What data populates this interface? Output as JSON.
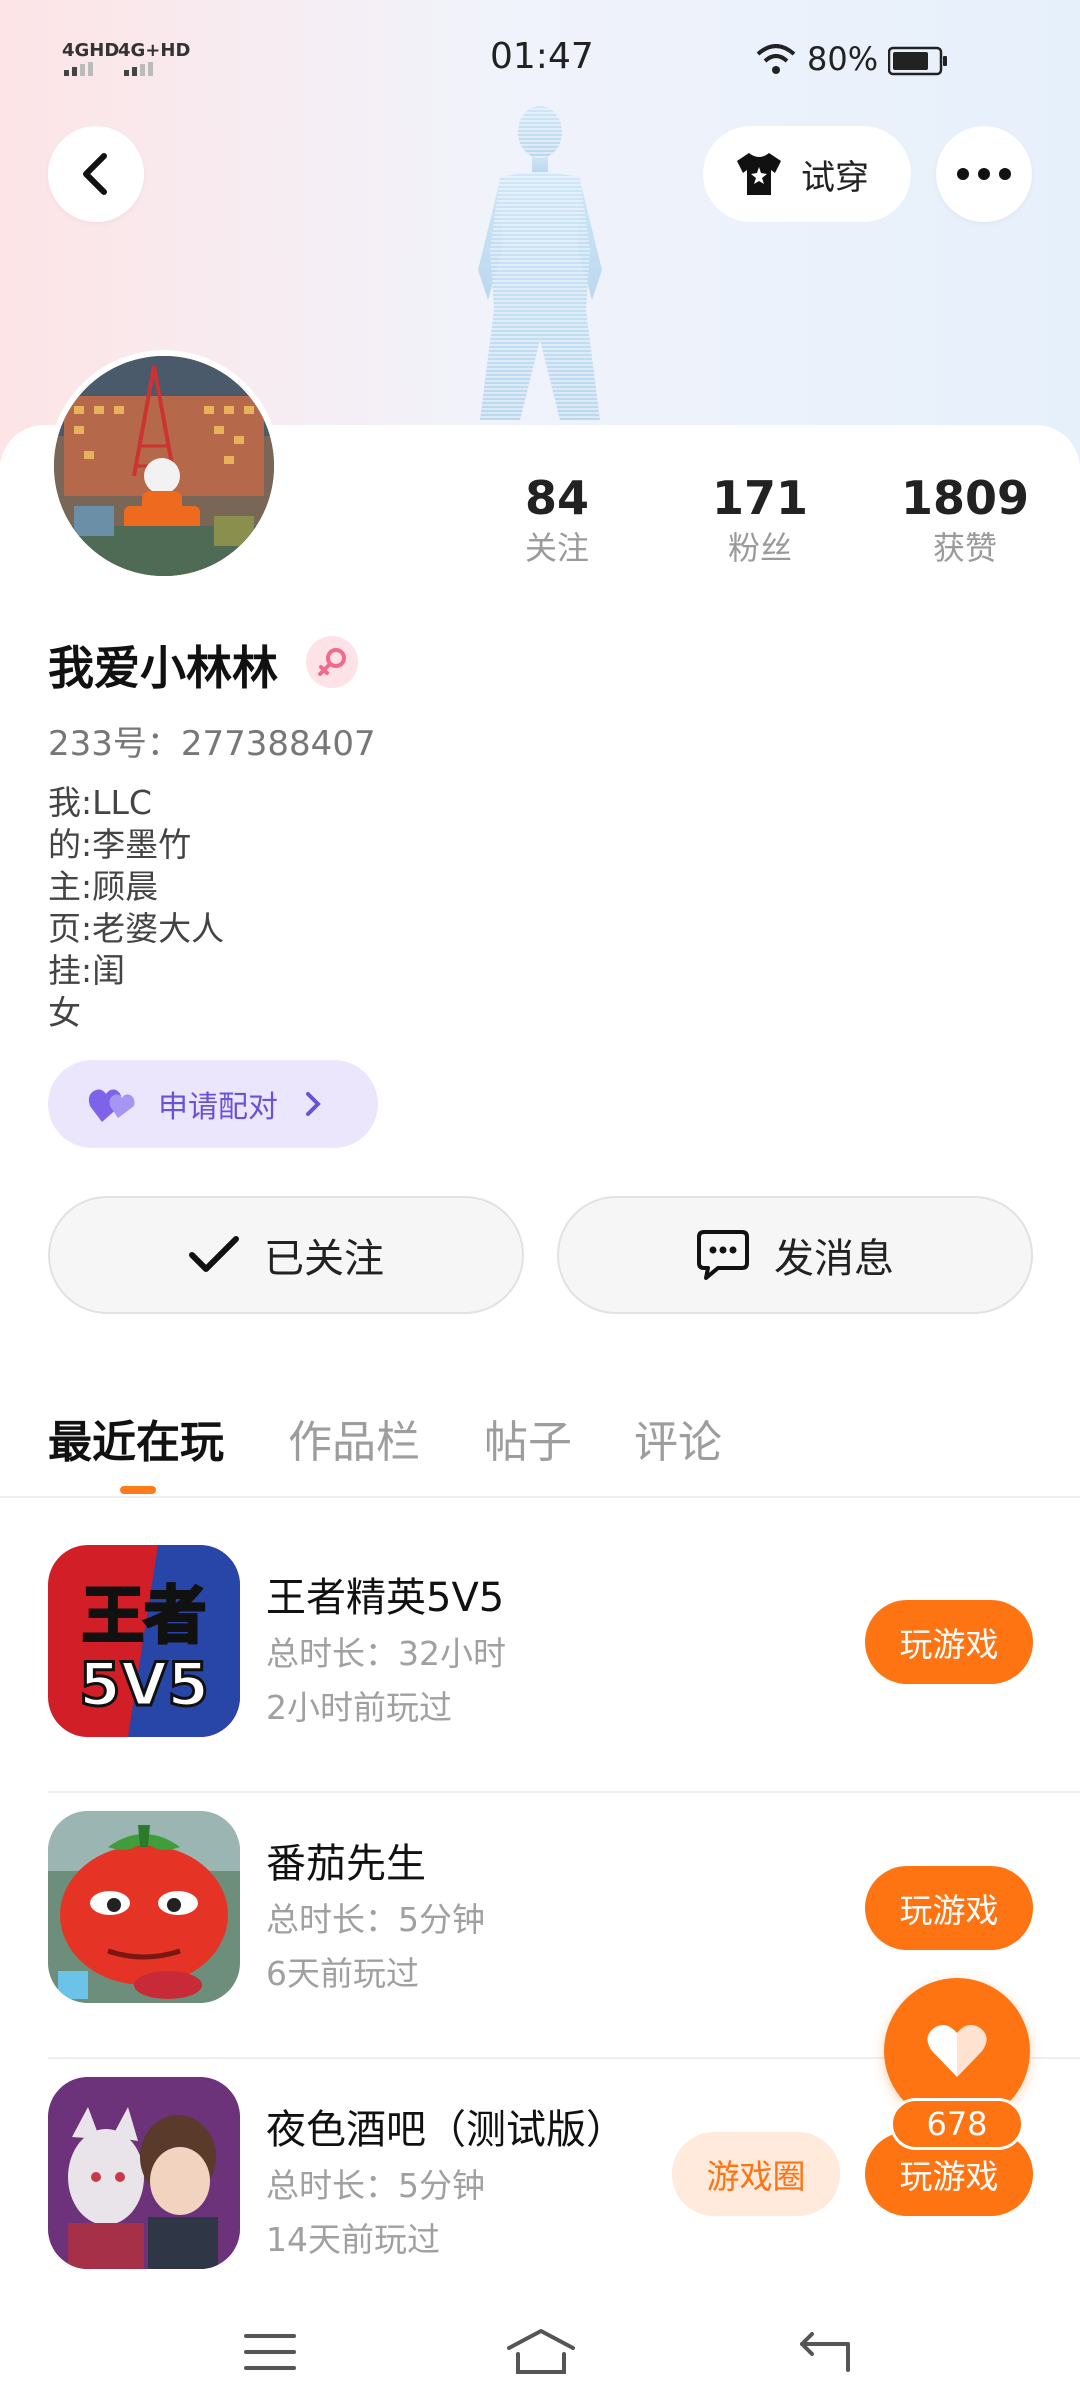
{
  "status_bar": {
    "net1": "4GHD",
    "net2": "4G+HD",
    "time": "01:47",
    "battery_pct": "80%",
    "battery_level": 0.8
  },
  "header": {
    "back_icon": "back-chevron-icon",
    "tryon_label": "试穿",
    "tryon_icon": "shirt-icon",
    "more_icon": "more-dots-icon"
  },
  "profile": {
    "nickname": "我爱小林林",
    "gender_icon": "female-icon",
    "uid": "233号：277388407",
    "bio": [
      "我:LLC",
      "的:李墨竹",
      "主:顾晨",
      "页:老婆大人",
      "挂:闺",
      "女"
    ],
    "pair_label": "申请配对",
    "stats": [
      {
        "num": "84",
        "label": "关注"
      },
      {
        "num": "171",
        "label": "粉丝"
      },
      {
        "num": "1809",
        "label": "获赞"
      }
    ]
  },
  "actions": {
    "follow_label": "已关注",
    "message_label": "发消息"
  },
  "tabs": [
    "最近在玩",
    "作品栏",
    "帖子",
    "评论"
  ],
  "games": [
    {
      "title": "王者精英5V5",
      "duration": "总时长：32小时",
      "last": "2小时前玩过",
      "play": "玩游戏",
      "icon_text_top": "王者",
      "icon_text_bottom": "5V5"
    },
    {
      "title": "番茄先生",
      "duration": "总时长：5分钟",
      "last": "6天前玩过",
      "play": "玩游戏"
    },
    {
      "title": "夜色酒吧（测试版）",
      "duration": "总时长：5分钟",
      "last": "14天前玩过",
      "play": "玩游戏",
      "circle": "游戏圈"
    }
  ],
  "fab": {
    "count": "678",
    "icon": "heart-icon"
  },
  "colors": {
    "accent": "#ff7412",
    "pair": "#6a52d6"
  }
}
